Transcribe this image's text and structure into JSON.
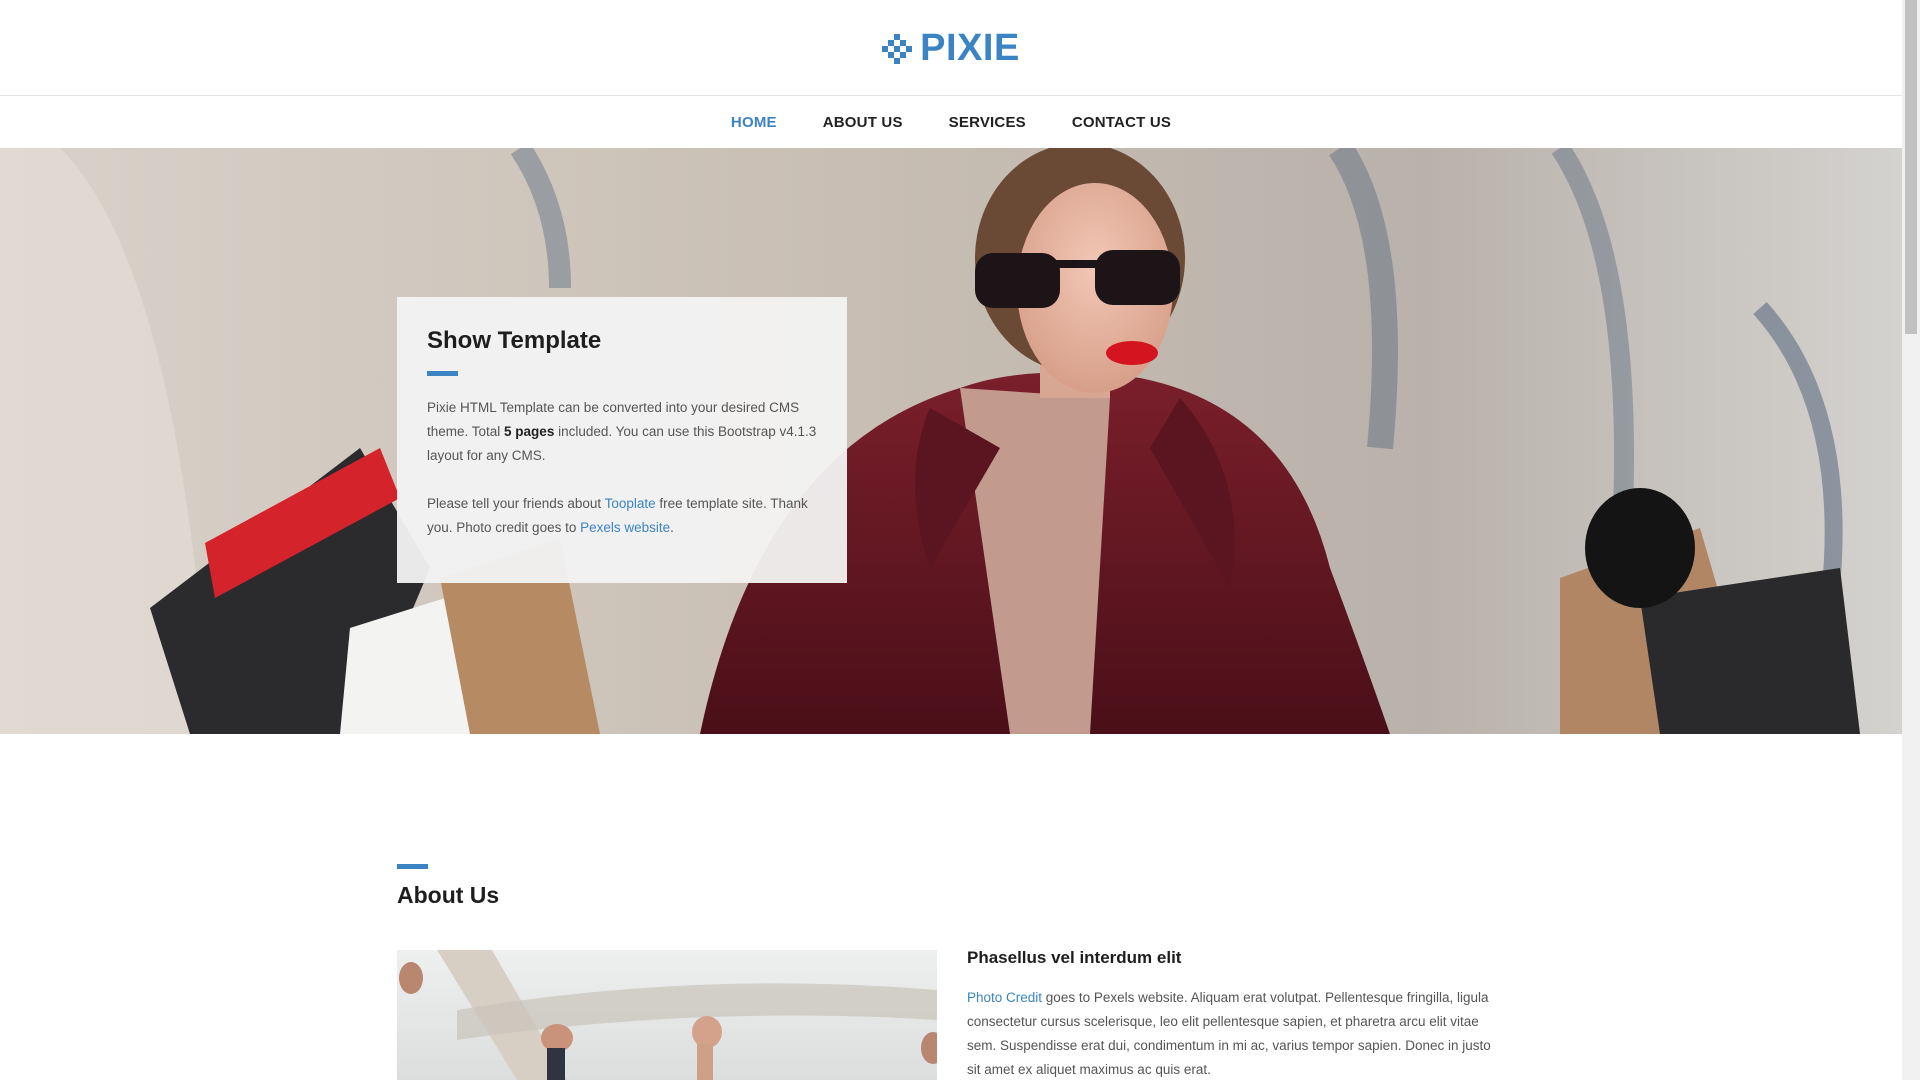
{
  "brand": {
    "name": "PIXIE",
    "icon": "pixel-diamond-icon",
    "color": "#3b84c4"
  },
  "nav": {
    "items": [
      {
        "label": "HOME",
        "active": true
      },
      {
        "label": "ABOUT US",
        "active": false
      },
      {
        "label": "SERVICES",
        "active": false
      },
      {
        "label": "CONTACT US",
        "active": false
      }
    ]
  },
  "hero": {
    "title": "Show Template",
    "p1_a": "Pixie HTML Template can be converted into your desired CMS theme. Total ",
    "p1_bold": "5 pages",
    "p1_b": " included. You can use this Bootstrap v4.1.3 layout for any CMS.",
    "p2_a": "Please tell your friends about ",
    "p2_link1": "Tooplate",
    "p2_b": " free template site. Thank you. Photo credit goes to ",
    "p2_link2": "Pexels website",
    "p2_c": "."
  },
  "about": {
    "title": "About Us",
    "subtitle": "Phasellus vel interdum elit",
    "link": "Photo Credit",
    "text": " goes to Pexels website. Aliquam erat volutpat. Pellentesque fringilla, ligula consectetur cursus scelerisque, leo elit pellentesque sapien, et pharetra arcu elit vitae sem. Suspendisse erat dui, condimentum in mi ac, varius tempor sapien. Donec in justo sit amet ex aliquet maximus ac quis erat."
  }
}
